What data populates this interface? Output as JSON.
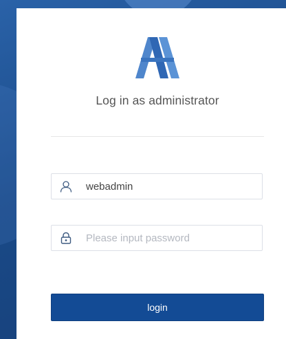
{
  "login": {
    "title": "Log in as administrator",
    "username_value": "webadmin",
    "password_placeholder": "Please input password",
    "submit_label": "login"
  },
  "colors": {
    "background": "#1d4f8f",
    "logo_light": "#5b8fd0",
    "logo_dark": "#2f67b4",
    "button": "#134b95",
    "icon": "#3d5a80"
  },
  "icons": {
    "logo": "brand-logo",
    "username": "user-icon",
    "password": "lock-icon"
  }
}
